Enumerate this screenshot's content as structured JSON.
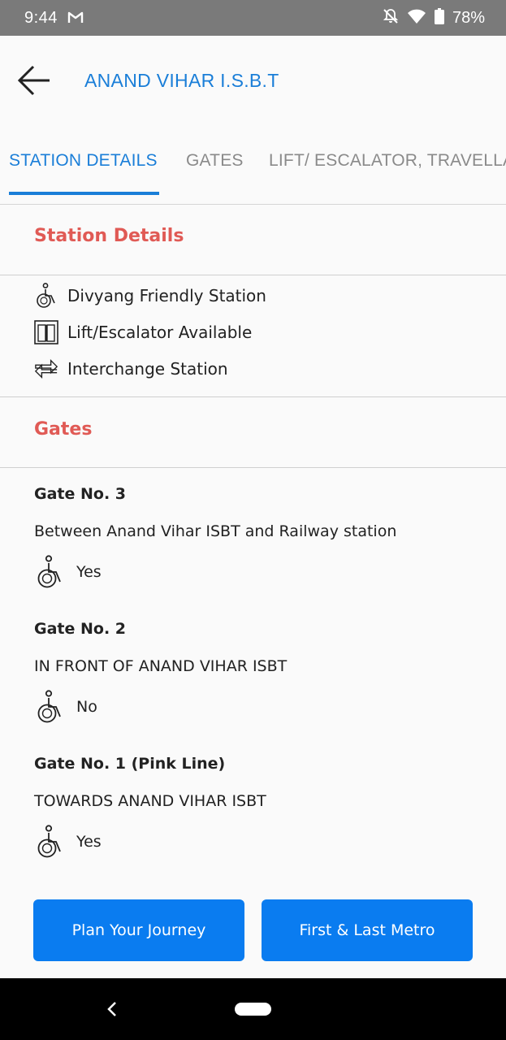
{
  "status_bar": {
    "time": "9:44",
    "battery": "78%",
    "icons": [
      "gmail-icon",
      "bell-off-icon",
      "wifi-icon",
      "battery-icon"
    ]
  },
  "app_bar": {
    "title": "ANAND VIHAR I.S.B.T",
    "back_icon": "arrow-left-icon"
  },
  "tabs": [
    {
      "label": "STATION DETAILS",
      "active": true
    },
    {
      "label": "GATES",
      "active": false
    },
    {
      "label": "LIFT/ ESCALATOR, TRAVELLATOR",
      "active": false
    }
  ],
  "station_details": {
    "heading": "Station Details",
    "features": [
      {
        "icon": "wheelchair-icon",
        "label": "Divyang Friendly Station"
      },
      {
        "icon": "lift-icon",
        "label": "Lift/Escalator Available"
      },
      {
        "icon": "interchange-icon",
        "label": "Interchange Station"
      }
    ]
  },
  "gates": {
    "heading": "Gates",
    "items": [
      {
        "title": "Gate No. 3",
        "description": "Between Anand Vihar ISBT and Railway station",
        "accessible": "Yes"
      },
      {
        "title": "Gate No. 2",
        "description": "IN FRONT OF ANAND VIHAR ISBT",
        "accessible": "No"
      },
      {
        "title": "Gate No. 1 (Pink Line)",
        "description": "TOWARDS ANAND VIHAR ISBT",
        "accessible": "Yes"
      }
    ]
  },
  "buttons": {
    "plan_journey": "Plan Your Journey",
    "first_last_metro": "First & Last Metro"
  },
  "colors": {
    "accent_blue": "#1a7ed8",
    "button_blue": "#0a7cf0",
    "section_red": "#e05a55"
  }
}
